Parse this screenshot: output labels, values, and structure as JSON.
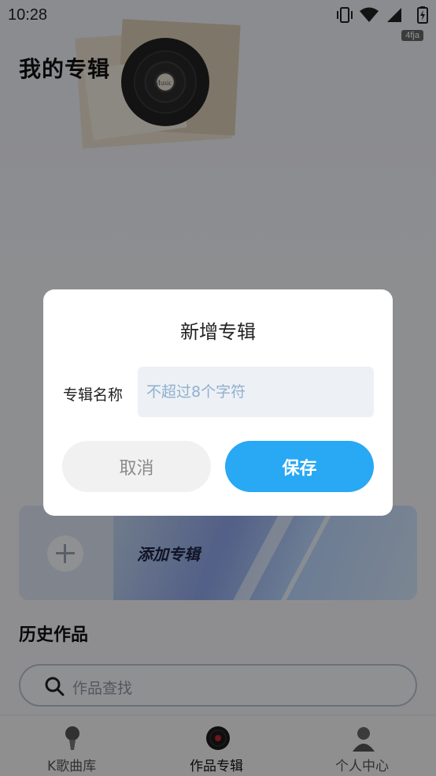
{
  "status_bar": {
    "time": "10:28",
    "badge": "4fja",
    "icons": [
      "vibrate-icon",
      "wifi-icon",
      "signal-icon",
      "battery-charging-icon"
    ]
  },
  "header": {
    "title": "我的专辑",
    "art_text": "Music"
  },
  "add_album": {
    "label": "添加专辑",
    "icon": "plus-icon"
  },
  "history": {
    "title": "历史作品",
    "search_placeholder": "作品查找"
  },
  "bottom_nav": {
    "items": [
      {
        "label": "K歌曲库",
        "icon": "microphone-icon",
        "active": false
      },
      {
        "label": "作品专辑",
        "icon": "vinyl-record-icon",
        "active": true
      },
      {
        "label": "个人中心",
        "icon": "user-avatar-icon",
        "active": false
      }
    ]
  },
  "dialog": {
    "title": "新增专辑",
    "field_label": "专辑名称",
    "input_value": "",
    "input_placeholder": "不超过8个字符",
    "cancel_label": "取消",
    "save_label": "保存"
  },
  "colors": {
    "accent": "#29a8f4",
    "scrim": "rgba(0,0,0,0.42)",
    "input_bg": "#edf0f5",
    "placeholder": "#8fb0cf"
  }
}
